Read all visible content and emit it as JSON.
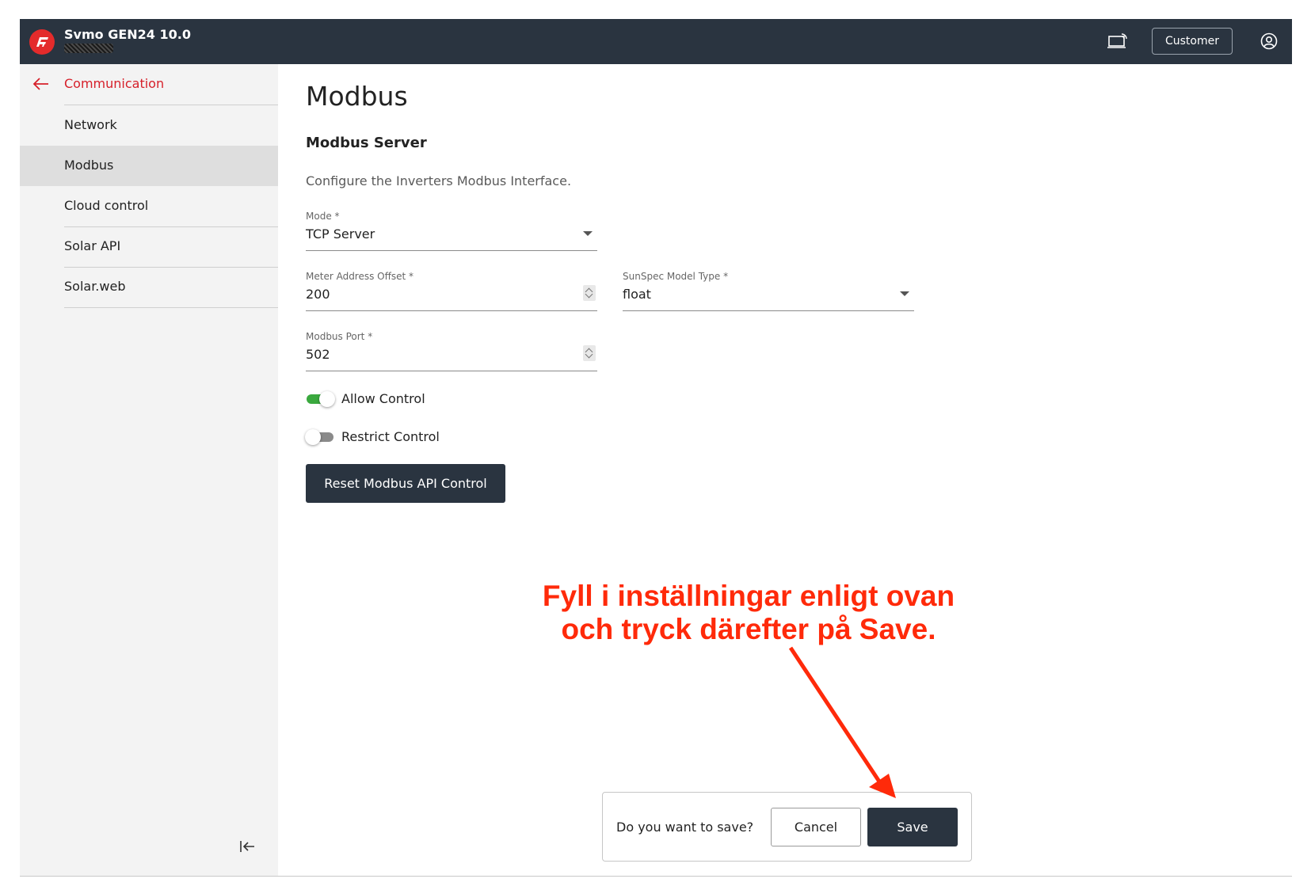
{
  "header": {
    "app_title": "Svmo GEN24 10.0",
    "customer_label": "Customer",
    "brand_color": "#e42b2b",
    "bar_color": "#2a3440"
  },
  "sidebar": {
    "back_label": "Communication",
    "items": [
      {
        "label": "Network",
        "active": false
      },
      {
        "label": "Modbus",
        "active": true
      },
      {
        "label": "Cloud control",
        "active": false
      },
      {
        "label": "Solar API",
        "active": false
      },
      {
        "label": "Solar.web",
        "active": false
      }
    ]
  },
  "main": {
    "title": "Modbus",
    "section_title": "Modbus Server",
    "section_desc": "Configure the Inverters Modbus Interface.",
    "mode": {
      "label": "Mode *",
      "value": "TCP Server"
    },
    "meter_offset": {
      "label": "Meter Address Offset *",
      "value": "200"
    },
    "sunspec": {
      "label": "SunSpec Model Type *",
      "value": "float"
    },
    "port": {
      "label": "Modbus Port *",
      "value": "502"
    },
    "allow_control": {
      "label": "Allow Control",
      "on": true
    },
    "restrict_control": {
      "label": "Restrict Control",
      "on": false
    },
    "reset_label": "Reset Modbus API Control"
  },
  "annotation": {
    "line1": "Fyll i inställningar enligt ovan",
    "line2": "och tryck därefter på Save.",
    "color": "#ff2a0a"
  },
  "save_bar": {
    "question": "Do you want to save?",
    "cancel_label": "Cancel",
    "save_label": "Save"
  }
}
